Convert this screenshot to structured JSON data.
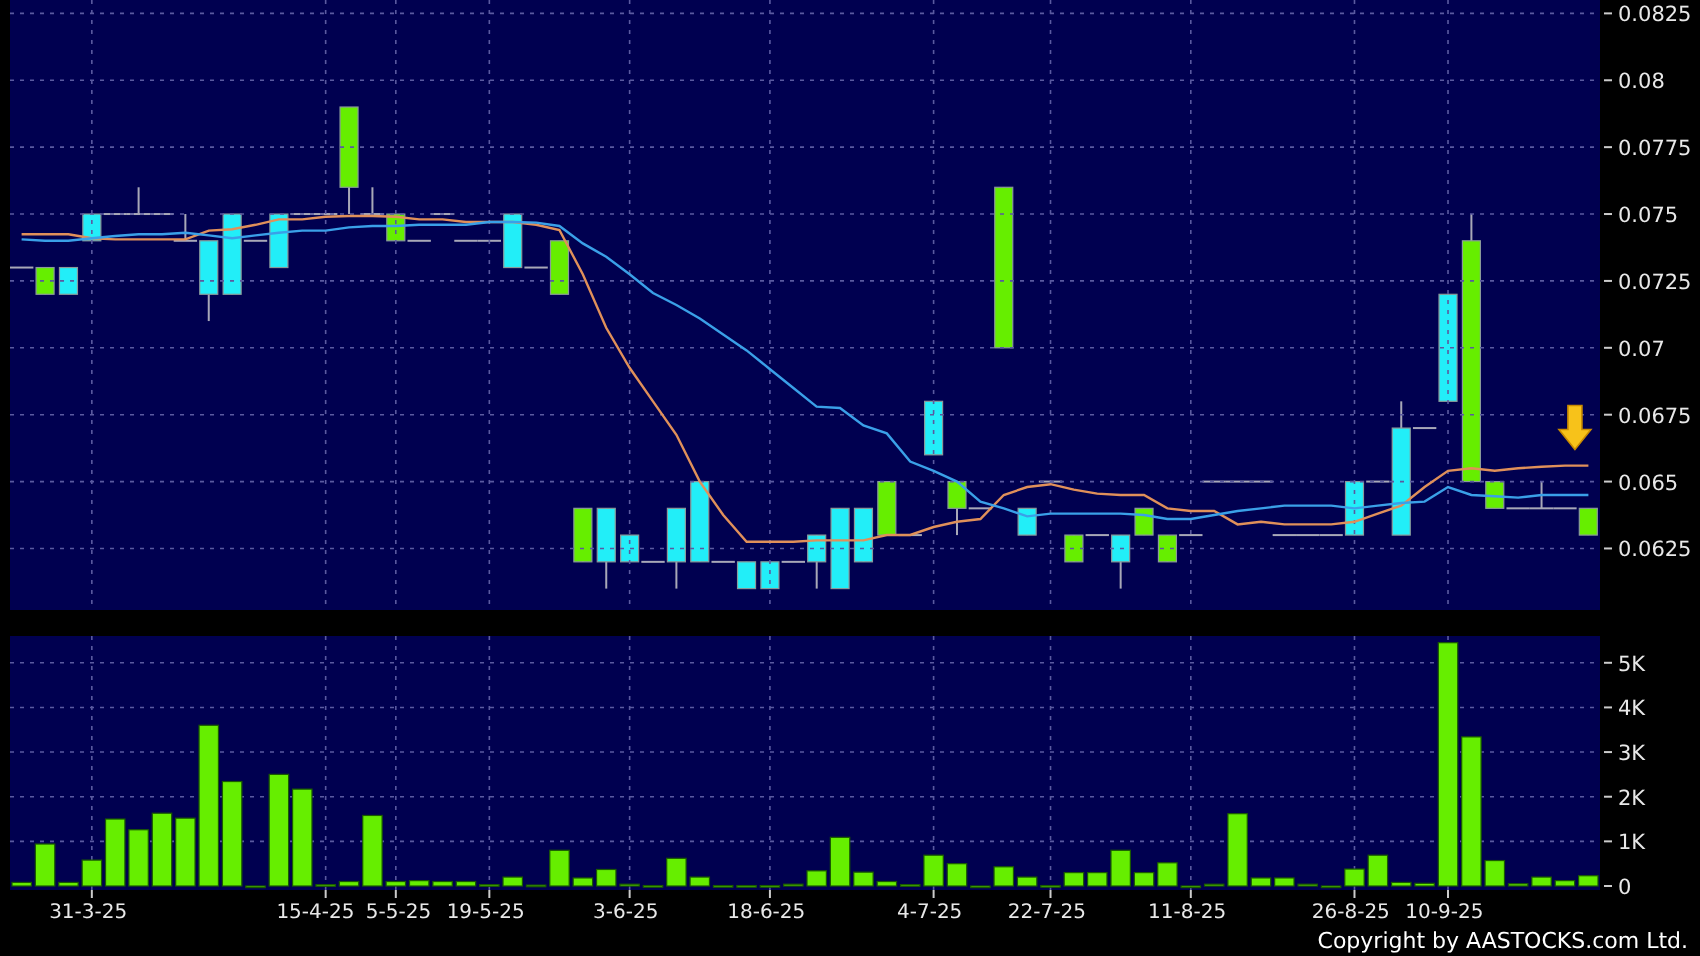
{
  "price_chart": {
    "chart_data": {
      "type": "line",
      "grid": true,
      "ylim": [
        0.0602,
        0.083
      ],
      "yticks": [
        {
          "value": 0.0625,
          "label": "0.0625"
        },
        {
          "value": 0.065,
          "label": "0.065"
        },
        {
          "value": 0.0675,
          "label": "0.0675"
        },
        {
          "value": 0.07,
          "label": "0.07"
        },
        {
          "value": 0.0725,
          "label": "0.0725"
        },
        {
          "value": 0.075,
          "label": "0.075"
        },
        {
          "value": 0.0775,
          "label": "0.0775"
        },
        {
          "value": 0.08,
          "label": "0.08"
        },
        {
          "value": 0.0825,
          "label": "0.0825"
        }
      ],
      "series": [
        {
          "color": "#e0905a",
          "values": [
            0.07425,
            0.07425,
            0.07425,
            0.0741,
            0.07405,
            0.07405,
            0.07405,
            0.07405,
            0.07438,
            0.07443,
            0.0746,
            0.0748,
            0.0748,
            0.0749,
            0.07493,
            0.07493,
            0.0749,
            0.0748,
            0.0748,
            0.0747,
            0.0747,
            0.0747,
            0.0746,
            0.0744,
            0.07275,
            0.07075,
            0.06925,
            0.068,
            0.06675,
            0.065,
            0.06375,
            0.06275,
            0.06275,
            0.06275,
            0.0628,
            0.0628,
            0.0628,
            0.063,
            0.063,
            0.0633,
            0.0635,
            0.0636,
            0.0645,
            0.0648,
            0.0649,
            0.0647,
            0.06455,
            0.0645,
            0.0645,
            0.064,
            0.0639,
            0.0639,
            0.0634,
            0.0635,
            0.0634,
            0.0634,
            0.0634,
            0.0635,
            0.0638,
            0.0641,
            0.0648,
            0.0654,
            0.0655,
            0.0654,
            0.0655,
            0.06555,
            0.0656,
            0.0656
          ]
        },
        {
          "color": "#3aa0e8",
          "values": [
            0.07405,
            0.074,
            0.074,
            0.0741,
            0.07418,
            0.07425,
            0.07425,
            0.0743,
            0.0742,
            0.0741,
            0.0742,
            0.0743,
            0.07438,
            0.07438,
            0.0745,
            0.07455,
            0.07455,
            0.0746,
            0.0746,
            0.0746,
            0.0747,
            0.0747,
            0.07468,
            0.07455,
            0.0739,
            0.0734,
            0.07275,
            0.07205,
            0.0716,
            0.0711,
            0.0705,
            0.0699,
            0.0692,
            0.0685,
            0.0678,
            0.06775,
            0.0671,
            0.0668,
            0.06575,
            0.0654,
            0.065,
            0.06425,
            0.064,
            0.0637,
            0.0638,
            0.0638,
            0.0638,
            0.0638,
            0.06375,
            0.0636,
            0.0636,
            0.06375,
            0.0639,
            0.064,
            0.0641,
            0.0641,
            0.0641,
            0.064,
            0.0641,
            0.0642,
            0.06425,
            0.0648,
            0.0645,
            0.06445,
            0.0644,
            0.0645,
            0.0645,
            0.0645
          ]
        }
      ]
    }
  },
  "volume_chart": {
    "chart_data": {
      "type": "bar",
      "grid": true,
      "ylim": [
        0,
        5.6
      ],
      "categories": [
        null,
        null,
        null,
        "31-3-25",
        null,
        null,
        null,
        null,
        null,
        null,
        null,
        null,
        null,
        "15-4-25",
        null,
        null,
        "5-5-25",
        null,
        null,
        null,
        "19-5-25",
        null,
        null,
        null,
        null,
        null,
        "3-6-25",
        null,
        null,
        null,
        null,
        null,
        "18-6-25",
        null,
        null,
        null,
        null,
        null,
        null,
        "4-7-25",
        null,
        null,
        null,
        null,
        "22-7-25",
        null,
        null,
        null,
        null,
        null,
        "11-8-25",
        null,
        null,
        null,
        null,
        null,
        null,
        "26-8-25",
        null,
        null,
        null,
        "10-9-25",
        null,
        null,
        null,
        null,
        null,
        null
      ],
      "yticks": [
        {
          "value": 0,
          "label": "0"
        },
        {
          "value": 1,
          "label": "1K"
        },
        {
          "value": 2,
          "label": "2K"
        },
        {
          "value": 3,
          "label": "3K"
        },
        {
          "value": 4,
          "label": "4K"
        },
        {
          "value": 5,
          "label": "5K"
        }
      ],
      "series": [
        {
          "color": "#66ee00",
          "values": [
            0.08,
            0.94,
            0.08,
            0.58,
            1.5,
            1.26,
            1.63,
            1.52,
            3.6,
            2.34,
            0,
            2.5,
            2.17,
            0.03,
            0.1,
            1.58,
            0.1,
            0.12,
            0.1,
            0.1,
            0.03,
            0.2,
            0.02,
            0.8,
            0.18,
            0.37,
            0.04,
            0.01,
            0.62,
            0.2,
            0.01,
            0.01,
            0.01,
            0.04,
            0.34,
            1.09,
            0.31,
            0.1,
            0.03,
            0.69,
            0.5,
            0,
            0.43,
            0.2,
            0.01,
            0.3,
            0.3,
            0.8,
            0.3,
            0.52,
            0,
            0.04,
            1.62,
            0.18,
            0.18,
            0.04,
            0,
            0.38,
            0.69,
            0.08,
            0.06,
            5.45,
            3.34,
            0.57,
            0.05,
            0.2,
            0.12,
            0.23
          ]
        }
      ]
    }
  },
  "copyright": "Copyright by AASTOCKS.com Ltd."
}
